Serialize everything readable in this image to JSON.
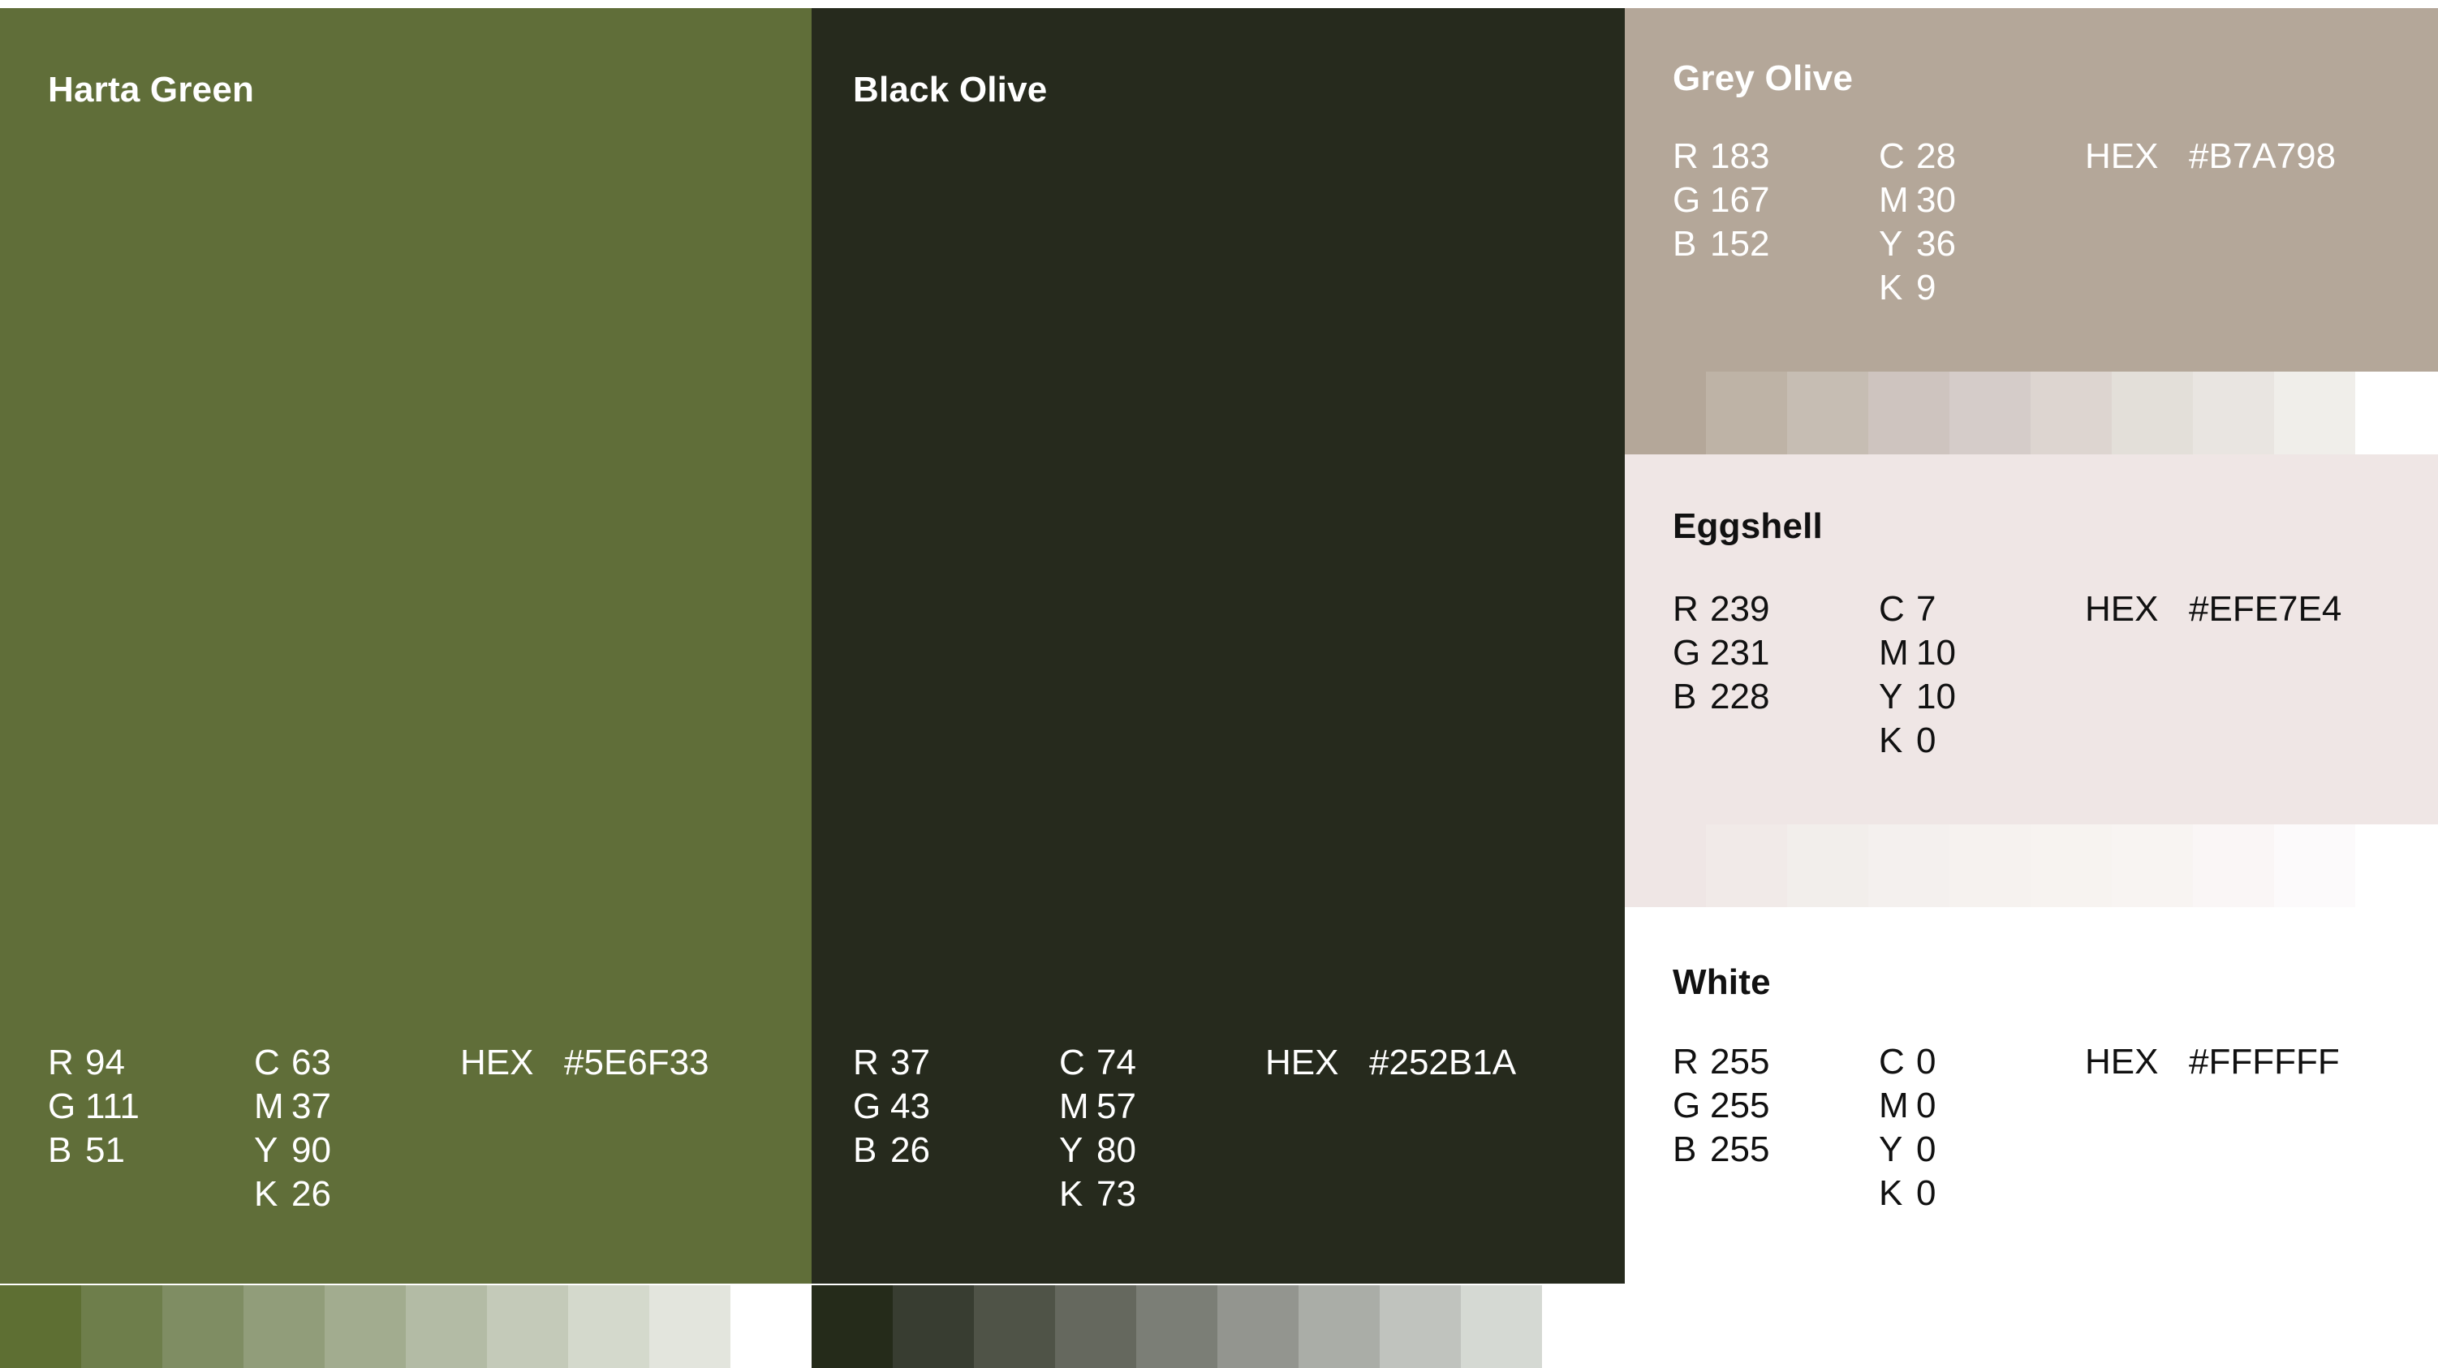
{
  "palette": [
    {
      "name": "Harta Green",
      "fill": "#606E39",
      "text_color": "#FFFFFF",
      "rgb": [
        [
          "R",
          "94"
        ],
        [
          "G",
          "111"
        ],
        [
          "B",
          "51"
        ]
      ],
      "cmyk": [
        [
          "C",
          "63"
        ],
        [
          "M",
          "37"
        ],
        [
          "Y",
          "90"
        ],
        [
          "K",
          "26"
        ]
      ],
      "hex_label": "HEX",
      "hex_value": "#5E6F33",
      "tints": [
        "#5E6F33",
        "#6E7E4B",
        "#7F8D63",
        "#919D7A",
        "#A2AC8F",
        "#B3BBA5",
        "#C4CAB9",
        "#D4D9CC",
        "#E3E5DD"
      ]
    },
    {
      "name": "Black Olive",
      "fill": "#262A1D",
      "text_color": "#FFFFFF",
      "rgb": [
        [
          "R",
          "37"
        ],
        [
          "G",
          "43"
        ],
        [
          "B",
          "26"
        ]
      ],
      "cmyk": [
        [
          "C",
          "74"
        ],
        [
          "M",
          "57"
        ],
        [
          "Y",
          "80"
        ],
        [
          "K",
          "73"
        ]
      ],
      "hex_label": "HEX",
      "hex_value": "#252B1A",
      "tints": [
        "#252B1A",
        "#383D31",
        "#4F5347",
        "#65685E",
        "#7B7E76",
        "#93958F",
        "#AAADA7",
        "#C0C3BE",
        "#D5D9D3"
      ]
    },
    {
      "name": "Grey Olive",
      "fill": "#B4A799",
      "text_color": "#FFFFFF",
      "rgb": [
        [
          "R",
          "183"
        ],
        [
          "G",
          "167"
        ],
        [
          "B",
          "152"
        ]
      ],
      "cmyk": [
        [
          "C",
          "28"
        ],
        [
          "M",
          "30"
        ],
        [
          "Y",
          "36"
        ],
        [
          "K",
          "9"
        ]
      ],
      "hex_label": "HEX",
      "hex_value": "#B7A798",
      "tints": [
        "#B4A799",
        "#BEB3A6",
        "#C6BDB3",
        "#CEC4BF",
        "#D5CCC9",
        "#DDD5D0",
        "#E3DFD9",
        "#E9E5E1",
        "#F0EEEA"
      ]
    },
    {
      "name": "Eggshell",
      "fill": "#EFE6E5",
      "text_color": "#111111",
      "rgb": [
        [
          "R",
          "239"
        ],
        [
          "G",
          "231"
        ],
        [
          "B",
          "228"
        ]
      ],
      "cmyk": [
        [
          "C",
          "7"
        ],
        [
          "M",
          "10"
        ],
        [
          "Y",
          "10"
        ],
        [
          "K",
          "0"
        ]
      ],
      "hex_label": "HEX",
      "hex_value": "#EFE7E4",
      "tints": [
        "#EFE6E5",
        "#F1EAE8",
        "#F2EEEB",
        "#F4F0EE",
        "#F6F2EF",
        "#F7F3F0",
        "#F8F4F2",
        "#FAF6F6",
        "#FCFAFB"
      ]
    },
    {
      "name": "White",
      "fill": "#FFFFFF",
      "text_color": "#111111",
      "rgb": [
        [
          "R",
          "255"
        ],
        [
          "G",
          "255"
        ],
        [
          "B",
          "255"
        ]
      ],
      "cmyk": [
        [
          "C",
          "0"
        ],
        [
          "M",
          "0"
        ],
        [
          "Y",
          "0"
        ],
        [
          "K",
          "0"
        ]
      ],
      "hex_label": "HEX",
      "hex_value": "#FFFFFF",
      "tints": []
    }
  ]
}
